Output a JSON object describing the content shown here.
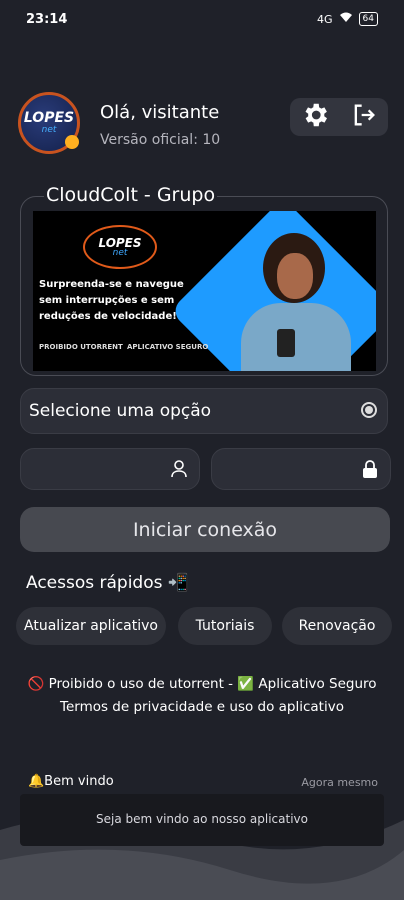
{
  "status_bar": {
    "time": "23:14",
    "signal": "4G",
    "battery": "64"
  },
  "header": {
    "logo_main": "LOPES",
    "logo_sub": "net",
    "greeting": "Olá, visitante",
    "version": "Versão oficial: 10"
  },
  "group_card": {
    "title": "CloudColt - Grupo",
    "banner": {
      "logo_main": "LOPES",
      "logo_sub": "net",
      "text": "Surpreenda-se e navegue sem interrupções e sem reduções de velocidade!",
      "footer_left": "PROIBIDO UTORRENT",
      "footer_right": "APLICATIVO SEGURO"
    }
  },
  "form": {
    "select_label": "Selecione uma opção",
    "username_placeholder": "",
    "password_placeholder": "",
    "connect_label": "Iniciar conexão"
  },
  "quick_access": {
    "title": "Acessos rápidos 📲",
    "buttons": [
      "Atualizar aplicativo",
      "Tutoriais",
      "Renovação"
    ]
  },
  "notice": {
    "line1": "🚫 Proibido o uso de utorrent - ✅ Aplicativo Seguro",
    "line2": "Termos de privacidade e uso do aplicativo"
  },
  "toast": {
    "title": "🔔Bem vindo",
    "time": "Agora mesmo",
    "message": "Seja bem vindo ao nosso aplicativo"
  },
  "colors": {
    "background": "#1f2129",
    "accent_orange": "#c8531f",
    "banner_blue": "#1e9bff"
  }
}
